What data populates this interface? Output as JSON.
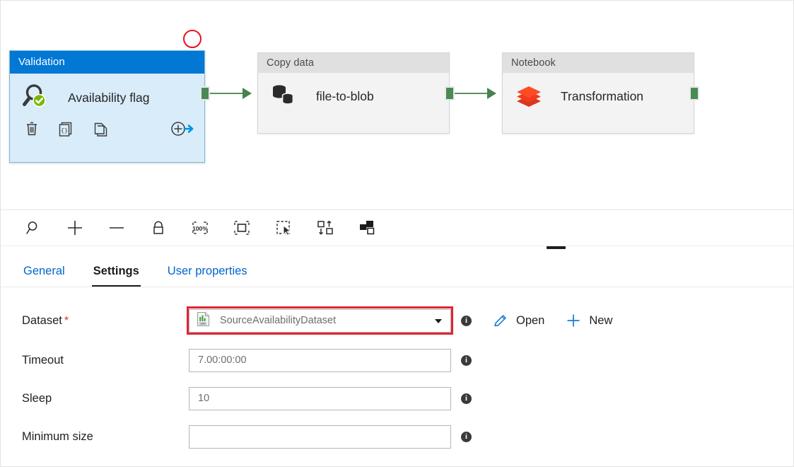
{
  "canvas": {
    "nodes": [
      {
        "type_label": "Validation",
        "name": "Availability flag",
        "icon": "magnifier-check-icon",
        "selected": true,
        "actions": [
          {
            "name": "delete-activity-icon",
            "label": "Delete"
          },
          {
            "name": "code-activity-icon",
            "label": "Code"
          },
          {
            "name": "clone-activity-icon",
            "label": "Clone"
          },
          {
            "name": "add-output-icon",
            "label": "Add output"
          }
        ]
      },
      {
        "type_label": "Copy data",
        "name": "file-to-blob",
        "icon": "copy-data-icon",
        "selected": false,
        "actions": []
      },
      {
        "type_label": "Notebook",
        "name": "Transformation",
        "icon": "databricks-notebook-icon",
        "selected": false,
        "actions": []
      }
    ],
    "annotation": {
      "name": "red-circle-annotation",
      "shape": "circle",
      "color": "#e81123"
    },
    "connector_color": "#4b8b53"
  },
  "toolbar": {
    "buttons": [
      {
        "name": "zoom-search-icon",
        "label": "Search"
      },
      {
        "name": "zoom-in-icon",
        "label": "Zoom in"
      },
      {
        "name": "zoom-out-icon",
        "label": "Zoom out"
      },
      {
        "name": "lock-icon",
        "label": "Lock canvas"
      },
      {
        "name": "zoom-100-percent-icon",
        "label": "100%"
      },
      {
        "name": "zoom-to-fit-icon",
        "label": "Zoom to fit"
      },
      {
        "name": "marquee-select-icon",
        "label": "Marquee select"
      },
      {
        "name": "auto-align-icon",
        "label": "Auto align"
      },
      {
        "name": "arrange-order-icon",
        "label": "Arrange"
      }
    ],
    "zoom_level_label": "100%"
  },
  "tabs": [
    {
      "label": "General",
      "active": false
    },
    {
      "label": "Settings",
      "active": true
    },
    {
      "label": "User properties",
      "active": false
    }
  ],
  "form": {
    "dataset": {
      "label": "Dataset",
      "required_marker": "*",
      "value": "SourceAvailabilityDataset",
      "icon": "csv-dataset-icon",
      "highlighted": true,
      "open_label": "Open",
      "new_label": "New"
    },
    "timeout": {
      "label": "Timeout",
      "value": "7.00:00:00"
    },
    "sleep": {
      "label": "Sleep",
      "value": "10"
    },
    "minimum_size": {
      "label": "Minimum size",
      "value": ""
    }
  },
  "colors": {
    "accent": "#0078d4",
    "selected_node_body": "#d8ecf9",
    "connector_green": "#4b8b53",
    "annotation_red": "#e81123",
    "highlight_red": "#e02434",
    "required_red": "#d13438"
  }
}
